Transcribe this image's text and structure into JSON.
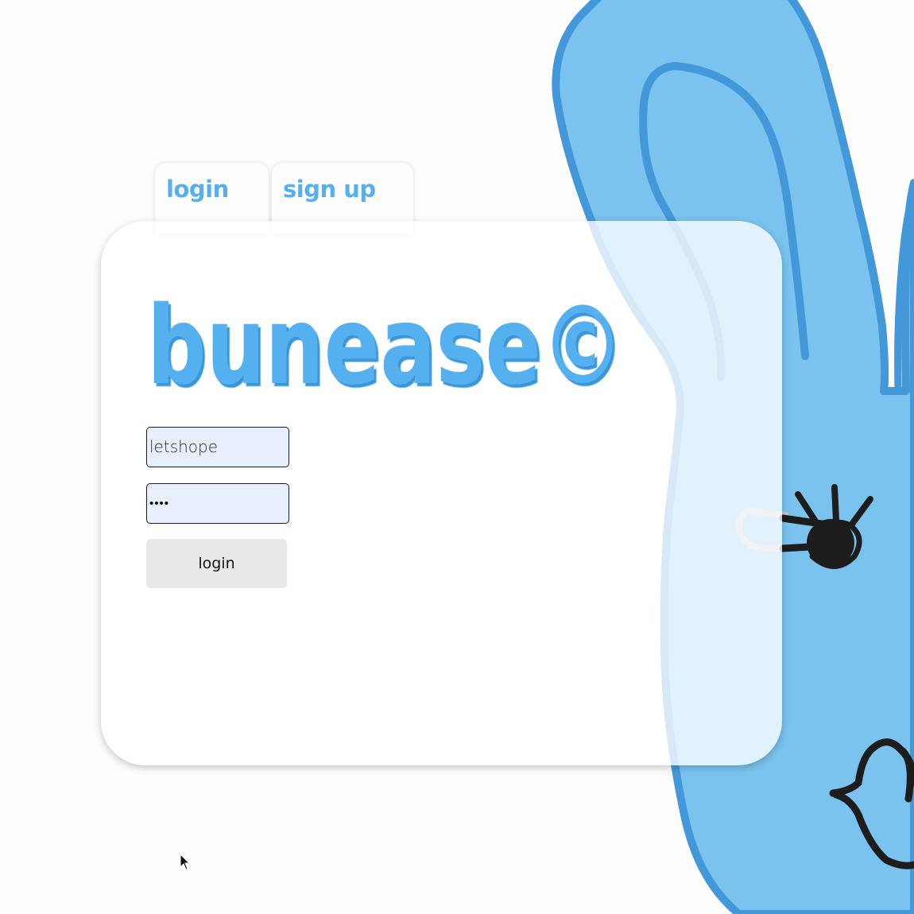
{
  "tabs": {
    "login_label": "login",
    "signup_label": "sign up"
  },
  "logo": {
    "text": "bunease©"
  },
  "form": {
    "username_value": "letshope",
    "password_value": "••••",
    "login_button_label": "login"
  },
  "colors": {
    "accent": "#55b0f0",
    "bunny_fill": "#79c3ee",
    "bunny_outline": "#4298d8",
    "input_bg": "#e7effc",
    "button_bg": "#e9e8e8"
  },
  "icons": {
    "cursor": "pointer-cursor-icon"
  }
}
